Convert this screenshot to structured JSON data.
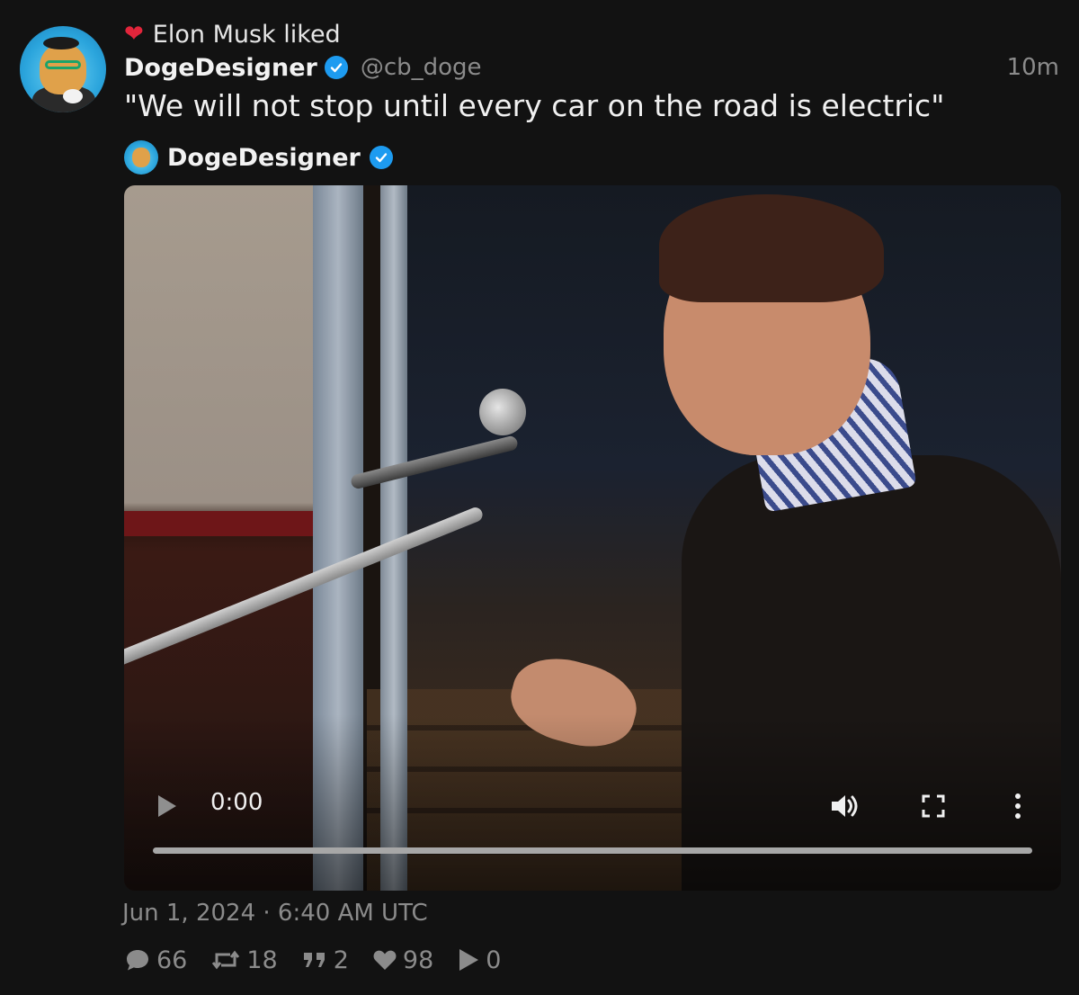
{
  "activity": {
    "icon": "heart-icon",
    "text": "Elon Musk liked"
  },
  "author": {
    "display_name": "DogeDesigner",
    "handle": "@cb_doge",
    "verified": true,
    "time_ago": "10m"
  },
  "tweet": {
    "text": "\"We will not stop until every car on the road is electric\""
  },
  "quoted": {
    "display_name": "DogeDesigner",
    "verified": true
  },
  "video": {
    "current_time": "0:00",
    "progress": 0
  },
  "post": {
    "date": "Jun 1, 2024 · 6:40 AM UTC"
  },
  "stats": {
    "replies": "66",
    "retweets": "18",
    "quotes": "2",
    "likes": "98",
    "views": "0"
  },
  "colors": {
    "background": "#121212",
    "verified": "#1d9bf0",
    "heart": "#e2253b",
    "muted_text": "#8b8b8b"
  }
}
